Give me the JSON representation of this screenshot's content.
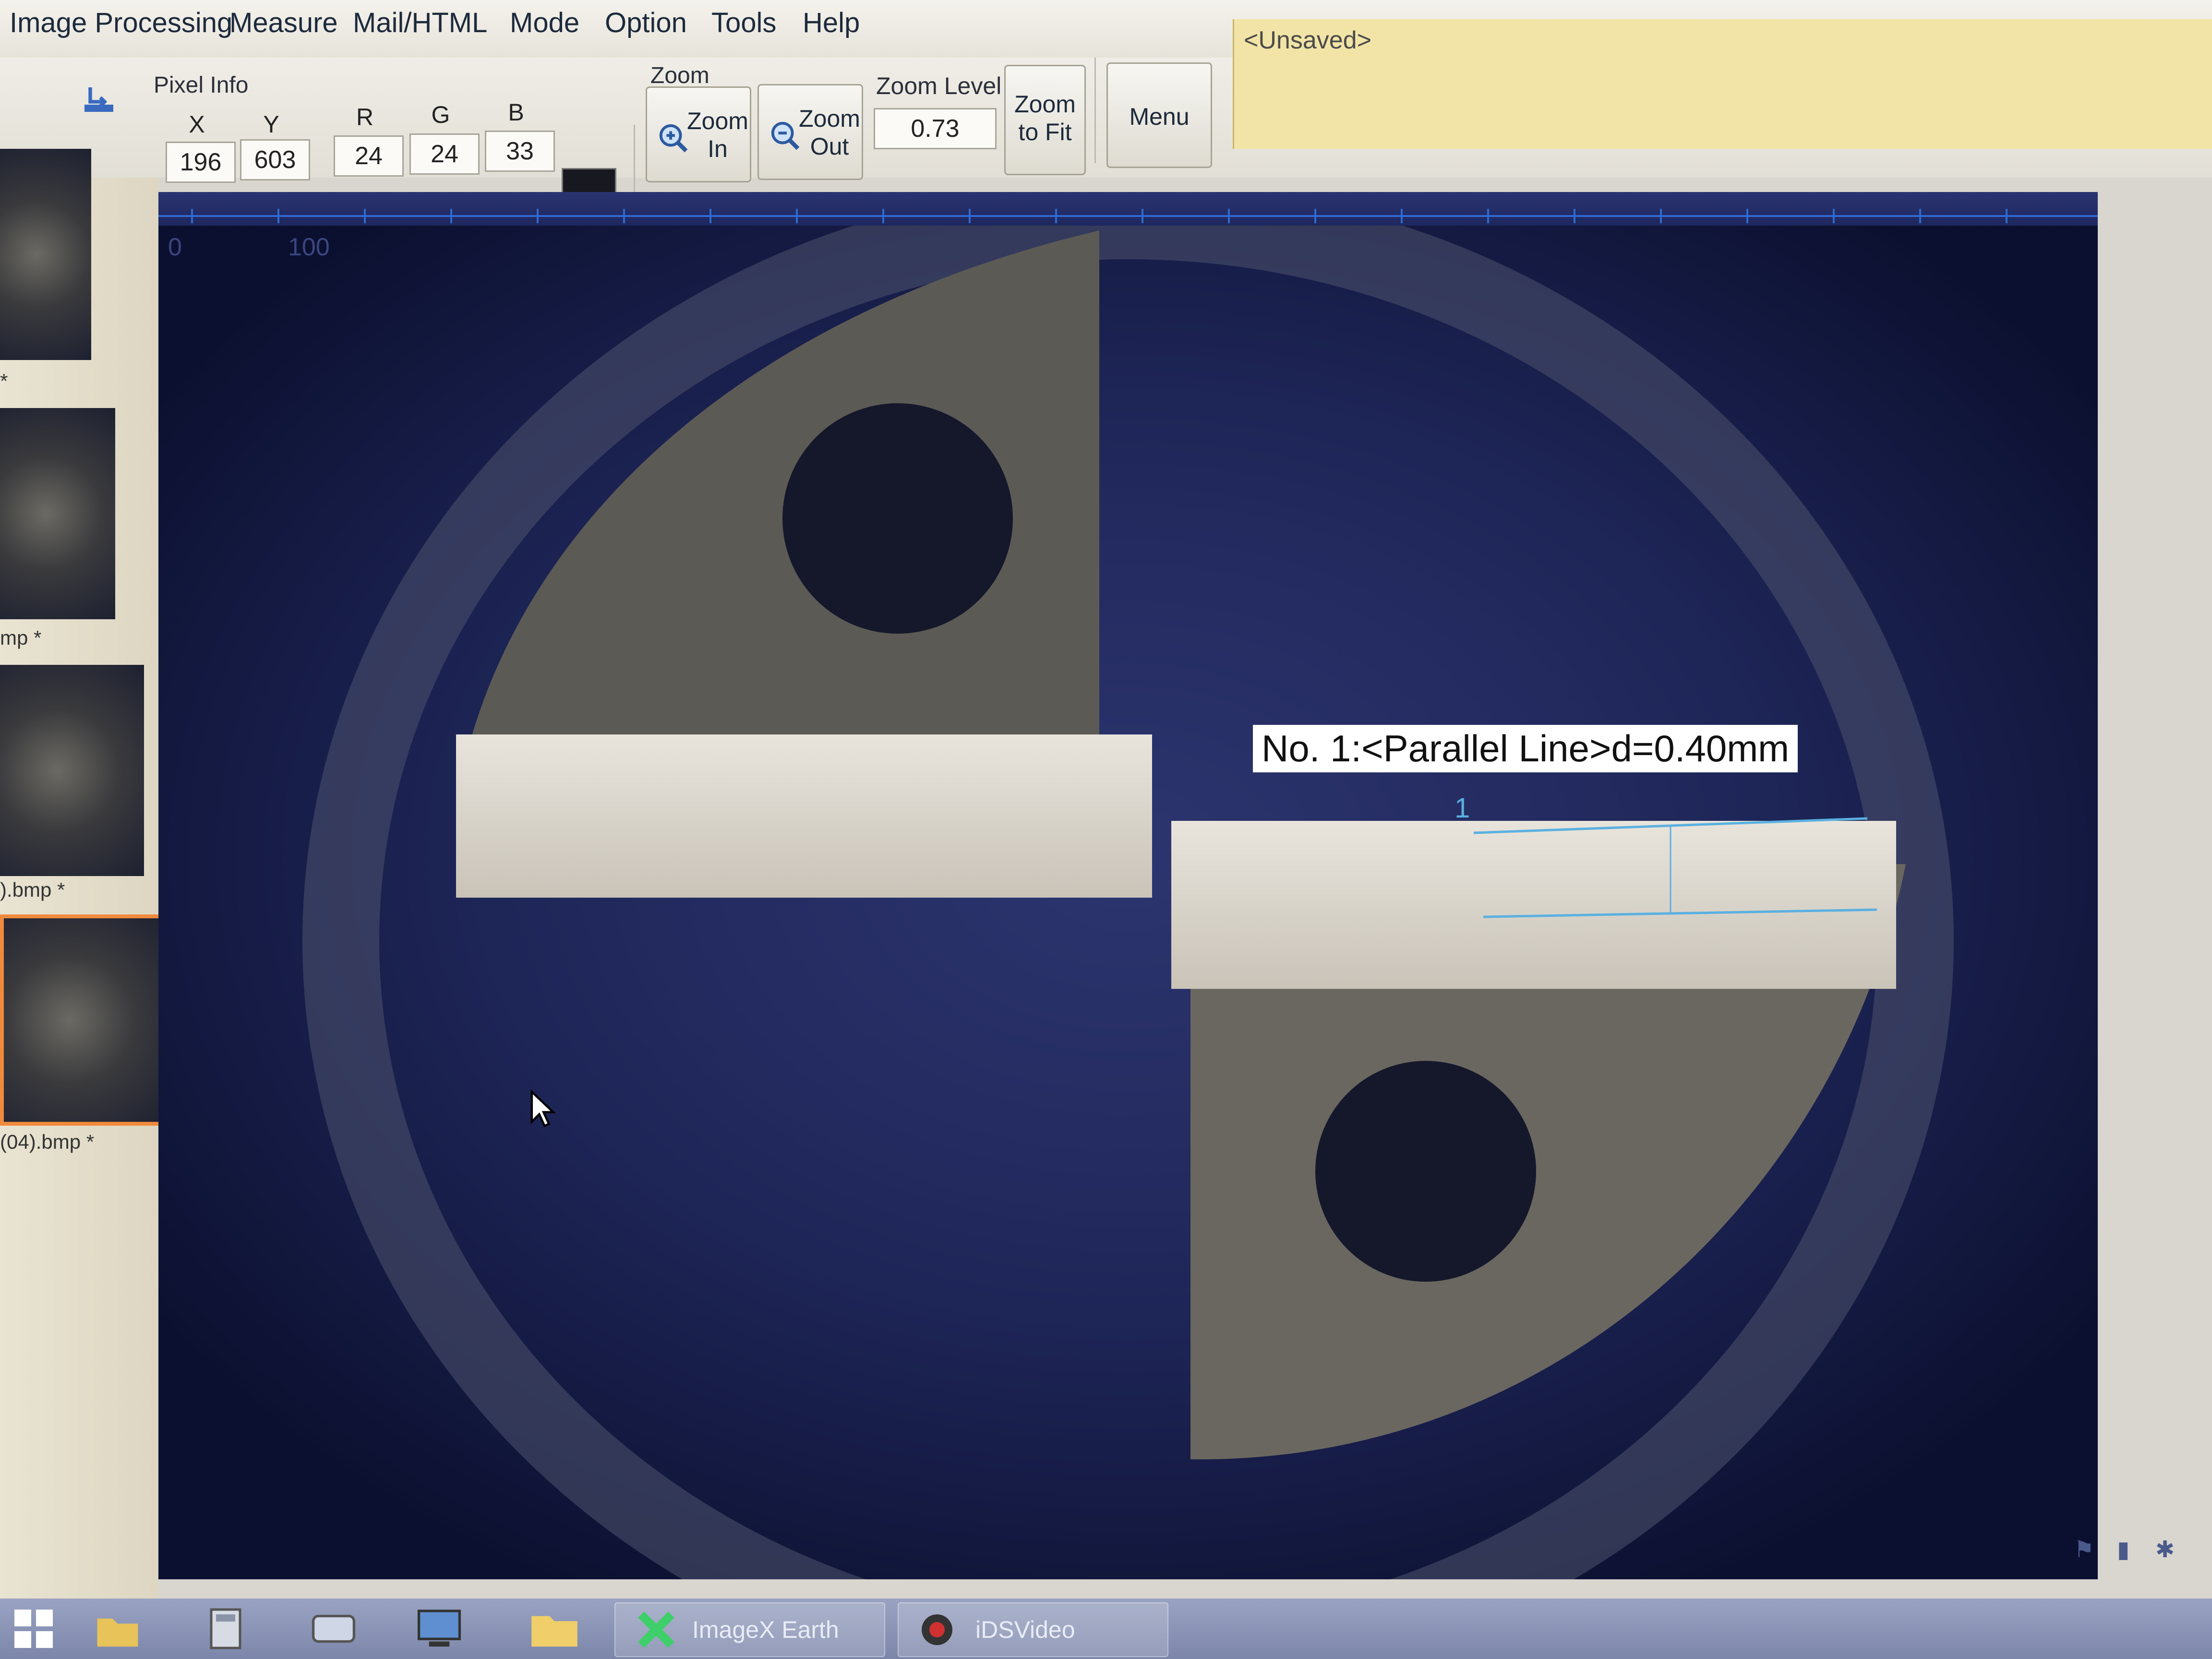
{
  "menubar": {
    "items": [
      "Image Processing",
      "Measure",
      "Mail/HTML",
      "Mode",
      "Option",
      "Tools",
      "Help"
    ]
  },
  "pixel_info": {
    "title": "Pixel Info",
    "x_label": "X",
    "y_label": "Y",
    "r_label": "R",
    "g_label": "G",
    "b_label": "B",
    "x": "196",
    "y": "603",
    "r": "24",
    "g": "24",
    "b": "33",
    "swatch_color": "#181820"
  },
  "zoom": {
    "title": "Zoom",
    "zoom_in": [
      "Zoom",
      "In"
    ],
    "zoom_out": [
      "Zoom",
      "Out"
    ],
    "zoom_level_label": "Zoom Level",
    "zoom_level_value": "0.73",
    "zoom_to_fit": [
      "Zoom",
      "to Fit"
    ]
  },
  "menu_button": "Menu",
  "document_state": "<Unsaved>",
  "thumbnails": [
    {
      "label": "*"
    },
    {
      "label": "mp *"
    },
    {
      "label": ").bmp *"
    },
    {
      "label": "(04).bmp *",
      "selected": true
    }
  ],
  "ruler": {
    "ticks": [
      "0",
      "100"
    ]
  },
  "measurement": {
    "label": "No. 1:<Parallel Line>d=0.40mm",
    "index": "1",
    "line_color": "#5ab0e0"
  },
  "taskbar": {
    "apps": [
      "ImageX Earth",
      "iDSVideo"
    ]
  },
  "accent_color": "#f08a3c"
}
